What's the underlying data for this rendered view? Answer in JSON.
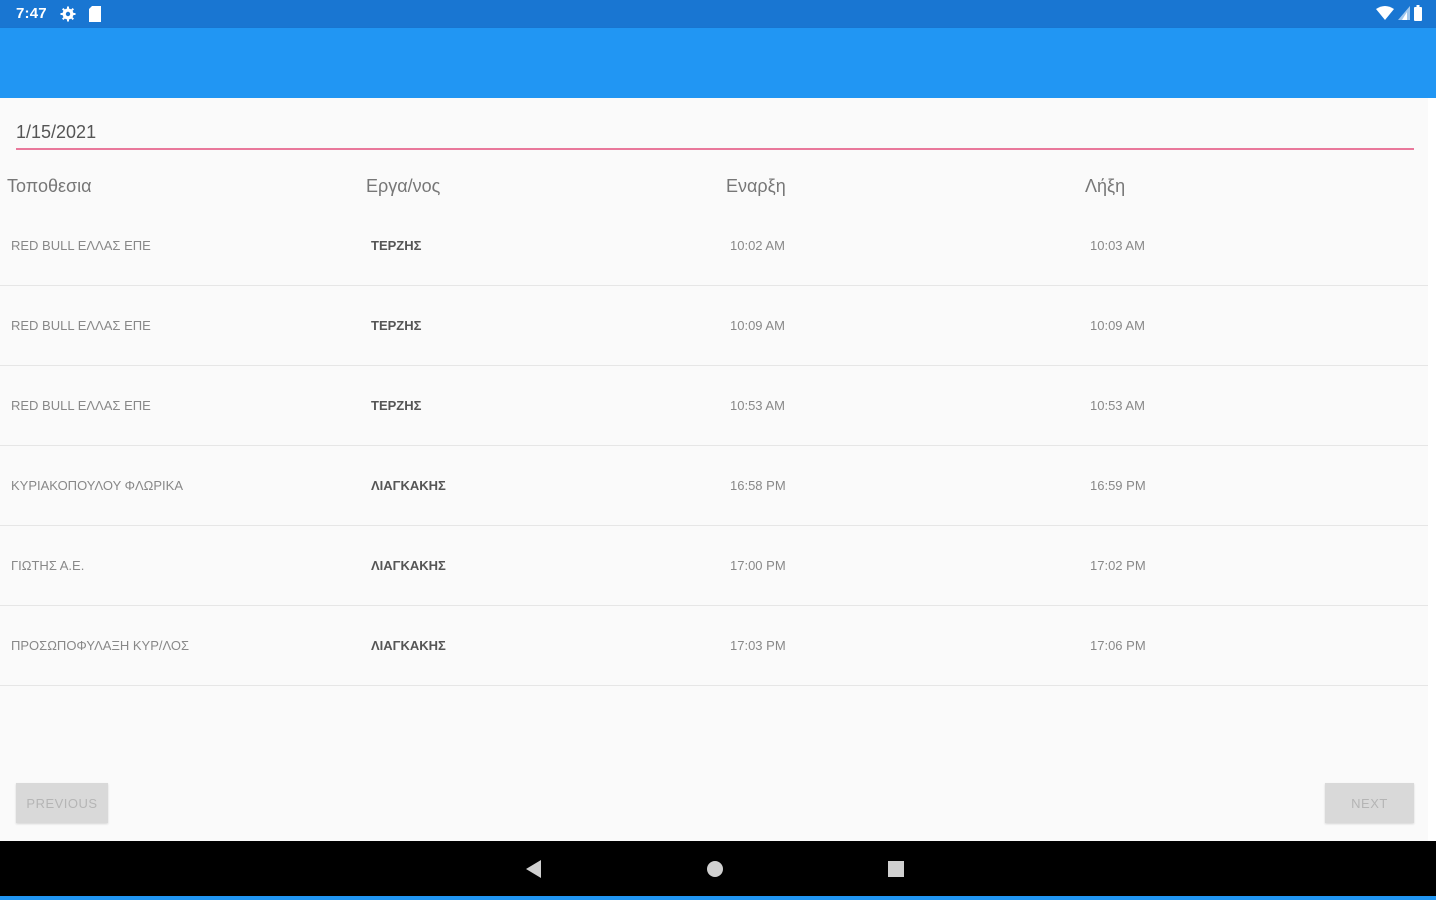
{
  "status_bar": {
    "time": "7:47",
    "icons": [
      "gear-icon",
      "sd-card-icon",
      "wifi-icon",
      "signal-icon",
      "battery-icon"
    ]
  },
  "colors": {
    "status_bar": "#1976d2",
    "app_bar": "#2196f3",
    "accent_underline": "#e9789b"
  },
  "date_field": {
    "value": "1/15/2021"
  },
  "table": {
    "headers": [
      "Τοποθεσια",
      "Εργα/νος",
      "Εναρξη",
      "Λήξη"
    ],
    "rows": [
      {
        "location": "RED BULL ΕΛΛΑΣ ΕΠΕ",
        "worker": "ΤΕΡΖΗΣ",
        "start": "10:02 AM",
        "end": "10:03 AM"
      },
      {
        "location": "RED BULL ΕΛΛΑΣ ΕΠΕ",
        "worker": "ΤΕΡΖΗΣ",
        "start": "10:09 AM",
        "end": "10:09 AM"
      },
      {
        "location": "RED BULL ΕΛΛΑΣ ΕΠΕ",
        "worker": "ΤΕΡΖΗΣ",
        "start": "10:53 AM",
        "end": "10:53 AM"
      },
      {
        "location": "ΚΥΡΙΑΚΟΠΟΥΛΟΥ ΦΛΩΡΙΚΑ",
        "worker": "ΛΙΑΓΚΑΚΗΣ",
        "start": "16:58 PM",
        "end": "16:59 PM"
      },
      {
        "location": "ΓΙΩΤΗΣ Α.Ε.",
        "worker": "ΛΙΑΓΚΑΚΗΣ",
        "start": "17:00 PM",
        "end": "17:02 PM"
      },
      {
        "location": "ΠΡΟΣΩΠΟΦΥΛΑΞΗ ΚΥΡ/ΛΟΣ",
        "worker": "ΛΙΑΓΚΑΚΗΣ",
        "start": "17:03 PM",
        "end": "17:06 PM"
      }
    ]
  },
  "buttons": {
    "previous": "PREVIOUS",
    "next": "NEXT"
  },
  "nav_bar": {
    "icons": [
      "back-icon",
      "home-icon",
      "recents-icon"
    ]
  }
}
